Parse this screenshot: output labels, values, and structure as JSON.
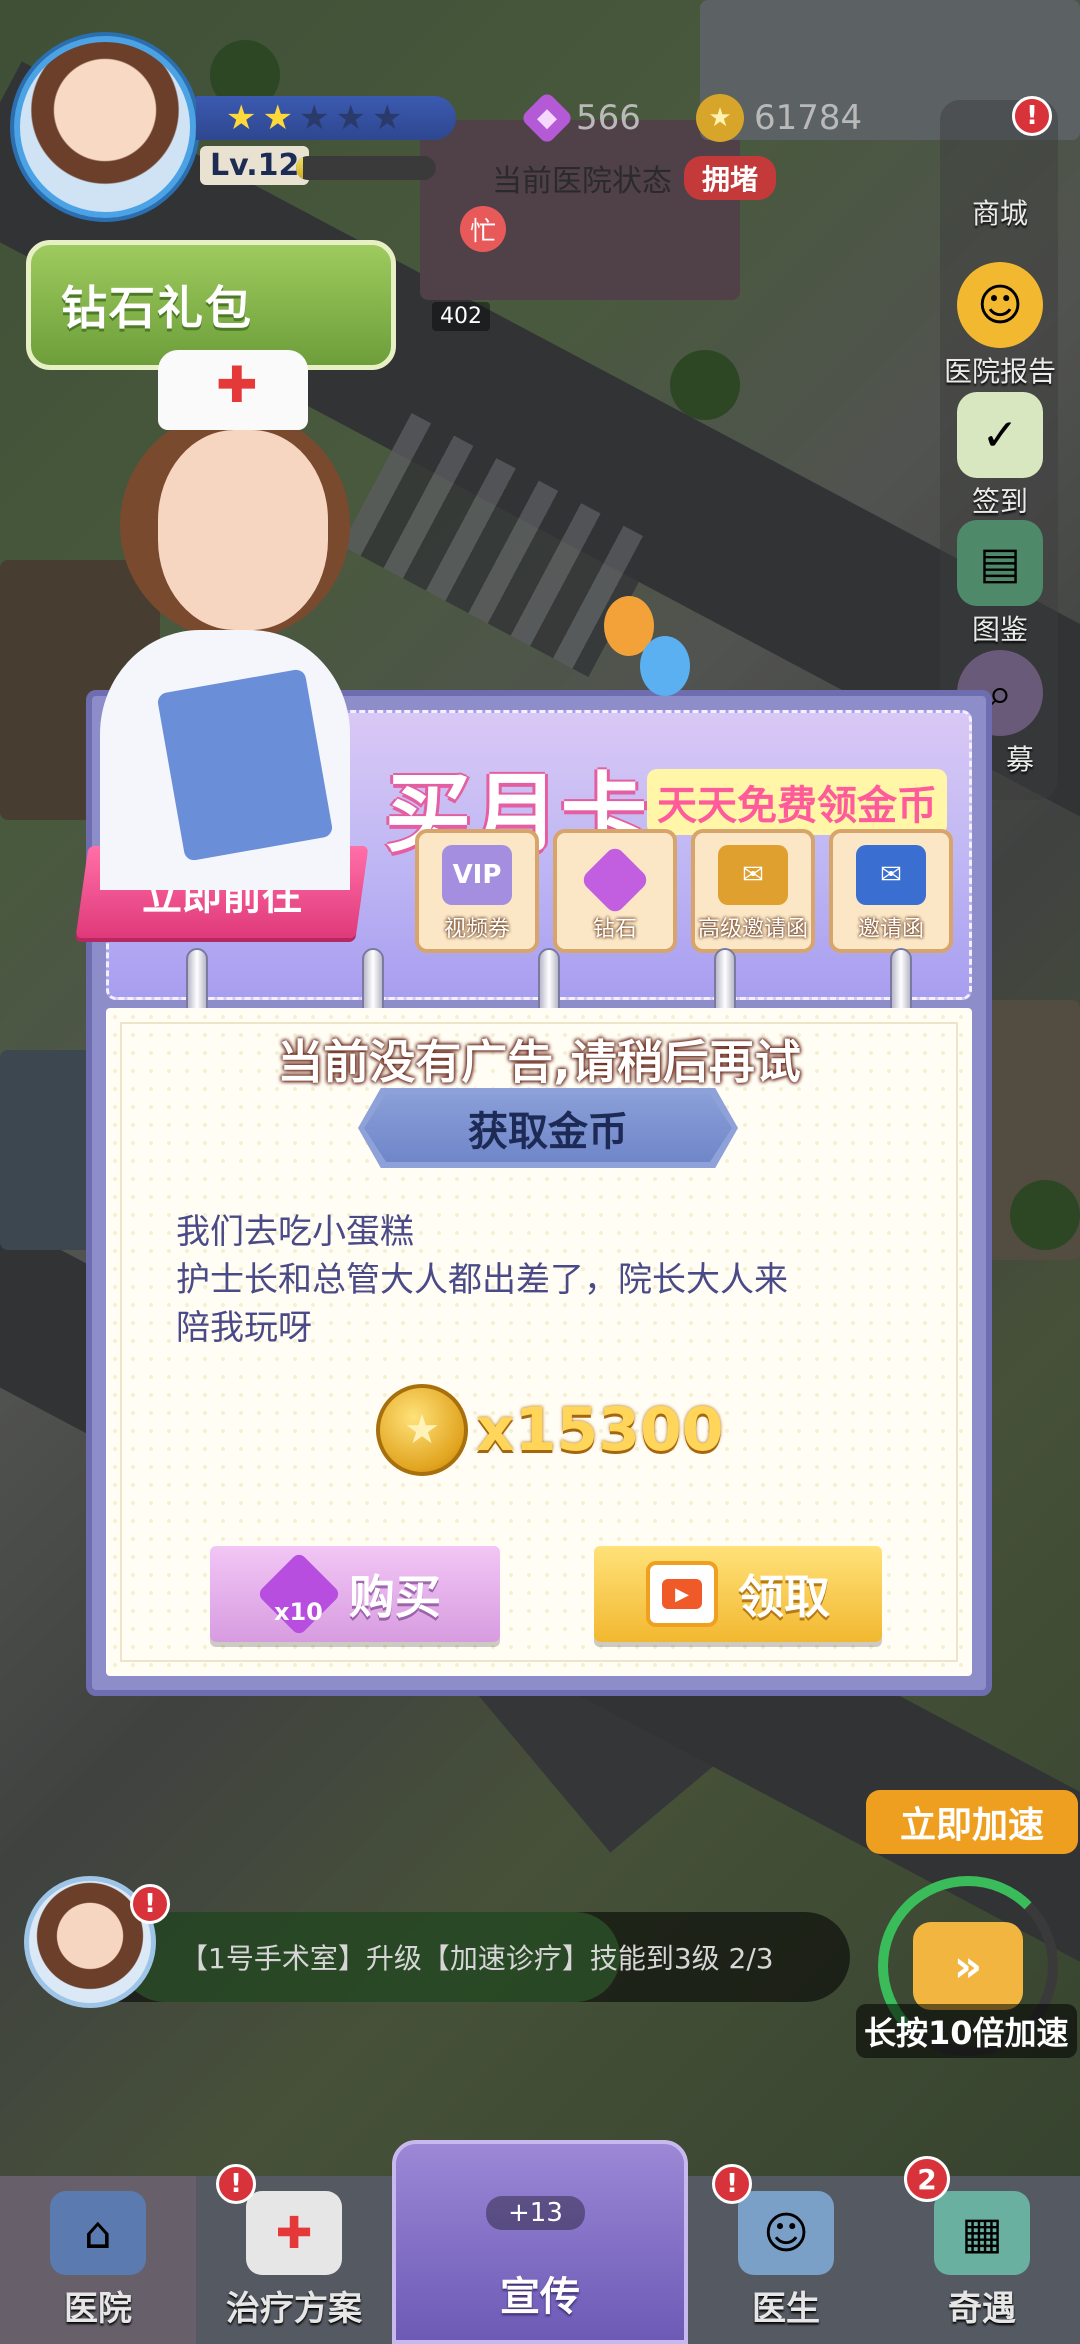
{
  "hud": {
    "stars_filled": 2,
    "stars_total": 5,
    "level": "Lv.12",
    "level_progress": 0.05,
    "diamonds": "566",
    "coins": "61784",
    "hospital_status_label": "当前医院状态",
    "hospital_status_value": "拥堵",
    "diamond_pack_label": "钻石礼包",
    "busy_badge": "忙",
    "count_label": "402"
  },
  "side_menu": {
    "items": [
      {
        "label": "商城",
        "icon": "shop-icon"
      },
      {
        "label": "医院报告",
        "icon": "report-icon"
      },
      {
        "label": "签到",
        "icon": "signin-icon"
      },
      {
        "label": "图鉴",
        "icon": "cards-icon"
      },
      {
        "label": "募",
        "icon": "recruit-icon"
      }
    ]
  },
  "modal": {
    "monthly_card_title": "买月卡",
    "monthly_card_subtitle": "天天免费领金币",
    "go_button_label": "立即前往",
    "reward_tiles": [
      {
        "label": "视频券",
        "icon": "vip-ticket-icon",
        "icon_text": "VIP"
      },
      {
        "label": "钻石",
        "icon": "diamond-icon",
        "icon_text": ""
      },
      {
        "label": "高级邀请函",
        "icon": "premium-invite-icon",
        "icon_text": ""
      },
      {
        "label": "邀请函",
        "icon": "invite-icon",
        "icon_text": ""
      }
    ],
    "toast": "当前没有广告,请稍后再试",
    "get_coins_label": "获取金币",
    "story_lines": [
      "我们去吃小蛋糕",
      "护士长和总管大人都出差了，院长大人来",
      "陪我玩呀"
    ],
    "reward_amount": "x15300",
    "buy_label": "购买",
    "buy_qty": "x10",
    "claim_label": "领取"
  },
  "bottom": {
    "speed_up_label": "立即加速",
    "hold_label": "长按10倍加速",
    "task_text": "【1号手术室】升级【加速诊疗】技能到3级  2/3",
    "nav": [
      {
        "label": "医院",
        "icon": "hospital-icon"
      },
      {
        "label": "治疗方案",
        "icon": "medkit-icon"
      },
      {
        "label": "宣传",
        "icon": "promo-icon"
      },
      {
        "label": "医生",
        "icon": "doctor-icon"
      },
      {
        "label": "奇遇",
        "icon": "adventure-icon"
      }
    ],
    "promo_plus": "+13",
    "event_badge": "2"
  },
  "colors": {
    "accent_pink": "#e45ea1",
    "modal_purple": "#8d8dc9",
    "coin_gold": "#ffd55a",
    "status_red": "#c43a3a"
  }
}
